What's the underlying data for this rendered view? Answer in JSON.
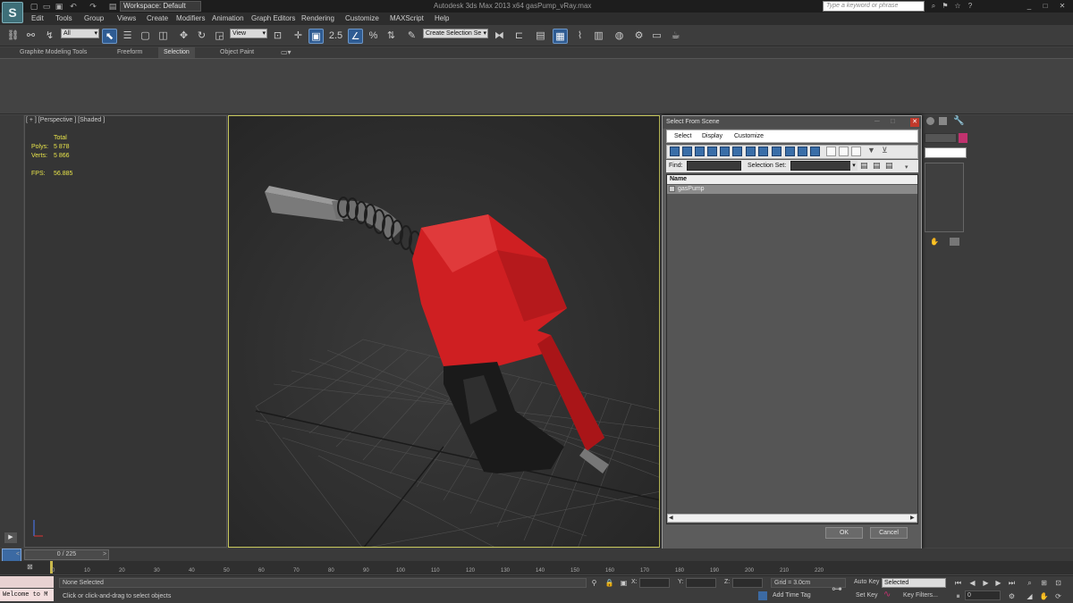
{
  "titlebar": {
    "workspace": "Workspace: Default",
    "window_title": "Autodesk 3ds Max 2013 x64    gasPump_vRay.max",
    "search_placeholder": "Type a keyword or phrase"
  },
  "menubar": [
    "Edit",
    "Tools",
    "Group",
    "Views",
    "Create",
    "Modifiers",
    "Animation",
    "Graph Editors",
    "Rendering",
    "Customize",
    "MAXScript",
    "Help"
  ],
  "toolbar": {
    "selection_filter": "All",
    "reference_coord": "View",
    "named_selection": "Create Selection Se"
  },
  "ribbon": {
    "tabs": [
      "Graphite Modeling Tools",
      "Freeform",
      "Selection",
      "Object Paint"
    ],
    "active_tab": "Selection"
  },
  "viewport": {
    "label": "[ + ] [Perspective ] [Shaded ]",
    "stats": {
      "total_label": "Total",
      "polys_label": "Polys:",
      "polys_value": "5 878",
      "verts_label": "Verts:",
      "verts_value": "5 866",
      "fps_label": "FPS:",
      "fps_value": "56.885"
    }
  },
  "dialog": {
    "title": "Select From Scene",
    "menu": [
      "Select",
      "Display",
      "Customize"
    ],
    "find_label": "Find:",
    "selection_set_label": "Selection Set:",
    "column_name": "Name",
    "items": [
      "gasPump"
    ],
    "ok": "OK",
    "cancel": "Cancel"
  },
  "timeline": {
    "frame_readout": "0 / 225",
    "ticks": [
      "0",
      "10",
      "20",
      "30",
      "40",
      "50",
      "60",
      "70",
      "80",
      "90",
      "100",
      "110",
      "120",
      "130",
      "140",
      "150",
      "160",
      "170",
      "180",
      "190",
      "200",
      "210",
      "220"
    ]
  },
  "status": {
    "listener": "Welcome to M",
    "selection": "None Selected",
    "prompt": "Click or click-and-drag to select objects",
    "x_label": "X:",
    "y_label": "Y:",
    "z_label": "Z:",
    "grid": "Grid = 3.0cm",
    "add_time_tag": "Add Time Tag",
    "auto_key": "Auto Key",
    "set_key": "Set Key",
    "key_mode": "Selected",
    "key_filters": "Key Filters...",
    "frame": "0"
  },
  "colors": {
    "accent": "#2f5c93",
    "object_swatch": "#c0326e",
    "pump_red": "#d42224"
  }
}
